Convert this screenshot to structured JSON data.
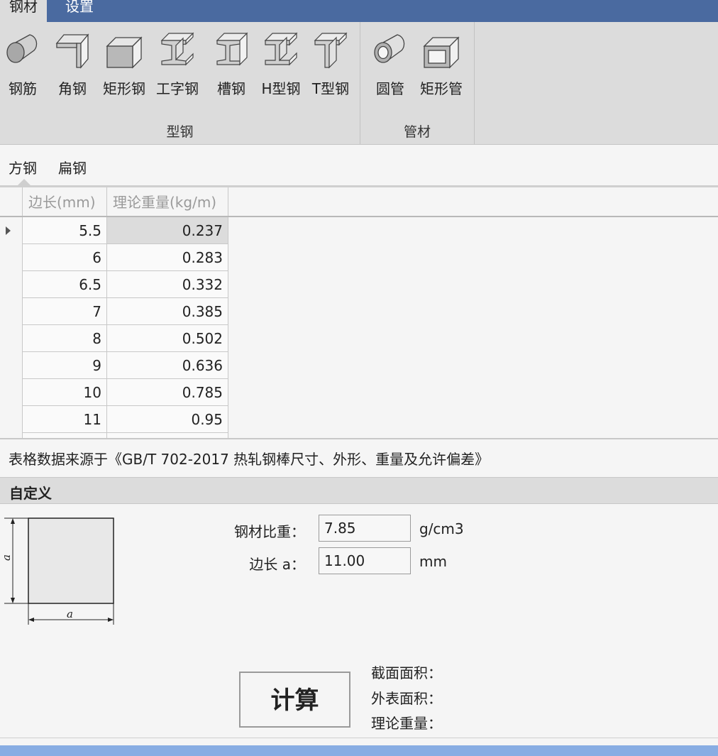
{
  "menu": {
    "steel": "钢材",
    "settings": "设置"
  },
  "ribbon": {
    "shapes_group": "型钢",
    "tubes_group": "管材",
    "shapes": [
      {
        "label": "钢筋",
        "icon": "rebar-icon"
      },
      {
        "label": "角钢",
        "icon": "angle-steel-icon"
      },
      {
        "label": "矩形钢",
        "icon": "rectangular-steel-icon"
      },
      {
        "label": "工字钢",
        "icon": "i-beam-icon"
      },
      {
        "label": "槽钢",
        "icon": "channel-steel-icon"
      },
      {
        "label": "H型钢",
        "icon": "h-beam-icon"
      },
      {
        "label": "T型钢",
        "icon": "t-beam-icon"
      }
    ],
    "tubes": [
      {
        "label": "圆管",
        "icon": "round-tube-icon"
      },
      {
        "label": "矩形管",
        "icon": "rectangular-tube-icon"
      }
    ]
  },
  "subtabs": {
    "square": "方钢",
    "flat": "扁钢"
  },
  "table": {
    "headers": {
      "side": "边长(mm)",
      "weight": "理论重量(kg/m)"
    },
    "rows": [
      {
        "side": "5.5",
        "weight": "0.237"
      },
      {
        "side": "6",
        "weight": "0.283"
      },
      {
        "side": "6.5",
        "weight": "0.332"
      },
      {
        "side": "7",
        "weight": "0.385"
      },
      {
        "side": "8",
        "weight": "0.502"
      },
      {
        "side": "9",
        "weight": "0.636"
      },
      {
        "side": "10",
        "weight": "0.785"
      },
      {
        "side": "11",
        "weight": "0.95"
      }
    ]
  },
  "source_note": "表格数据来源于《GB/T 702-2017 热轧钢棒尺寸、外形、重量及允许偏差》",
  "custom": {
    "title": "自定义",
    "diagram_label": "a",
    "density_label": "钢材比重：",
    "density_value": "7.85",
    "density_unit": "g/cm3",
    "side_label": "边长 a：",
    "side_value": "11.00",
    "side_unit": "mm",
    "calc_button": "计算",
    "area_label": "截面面积：",
    "surface_label": "外表面积：",
    "weight_label": "理论重量："
  }
}
